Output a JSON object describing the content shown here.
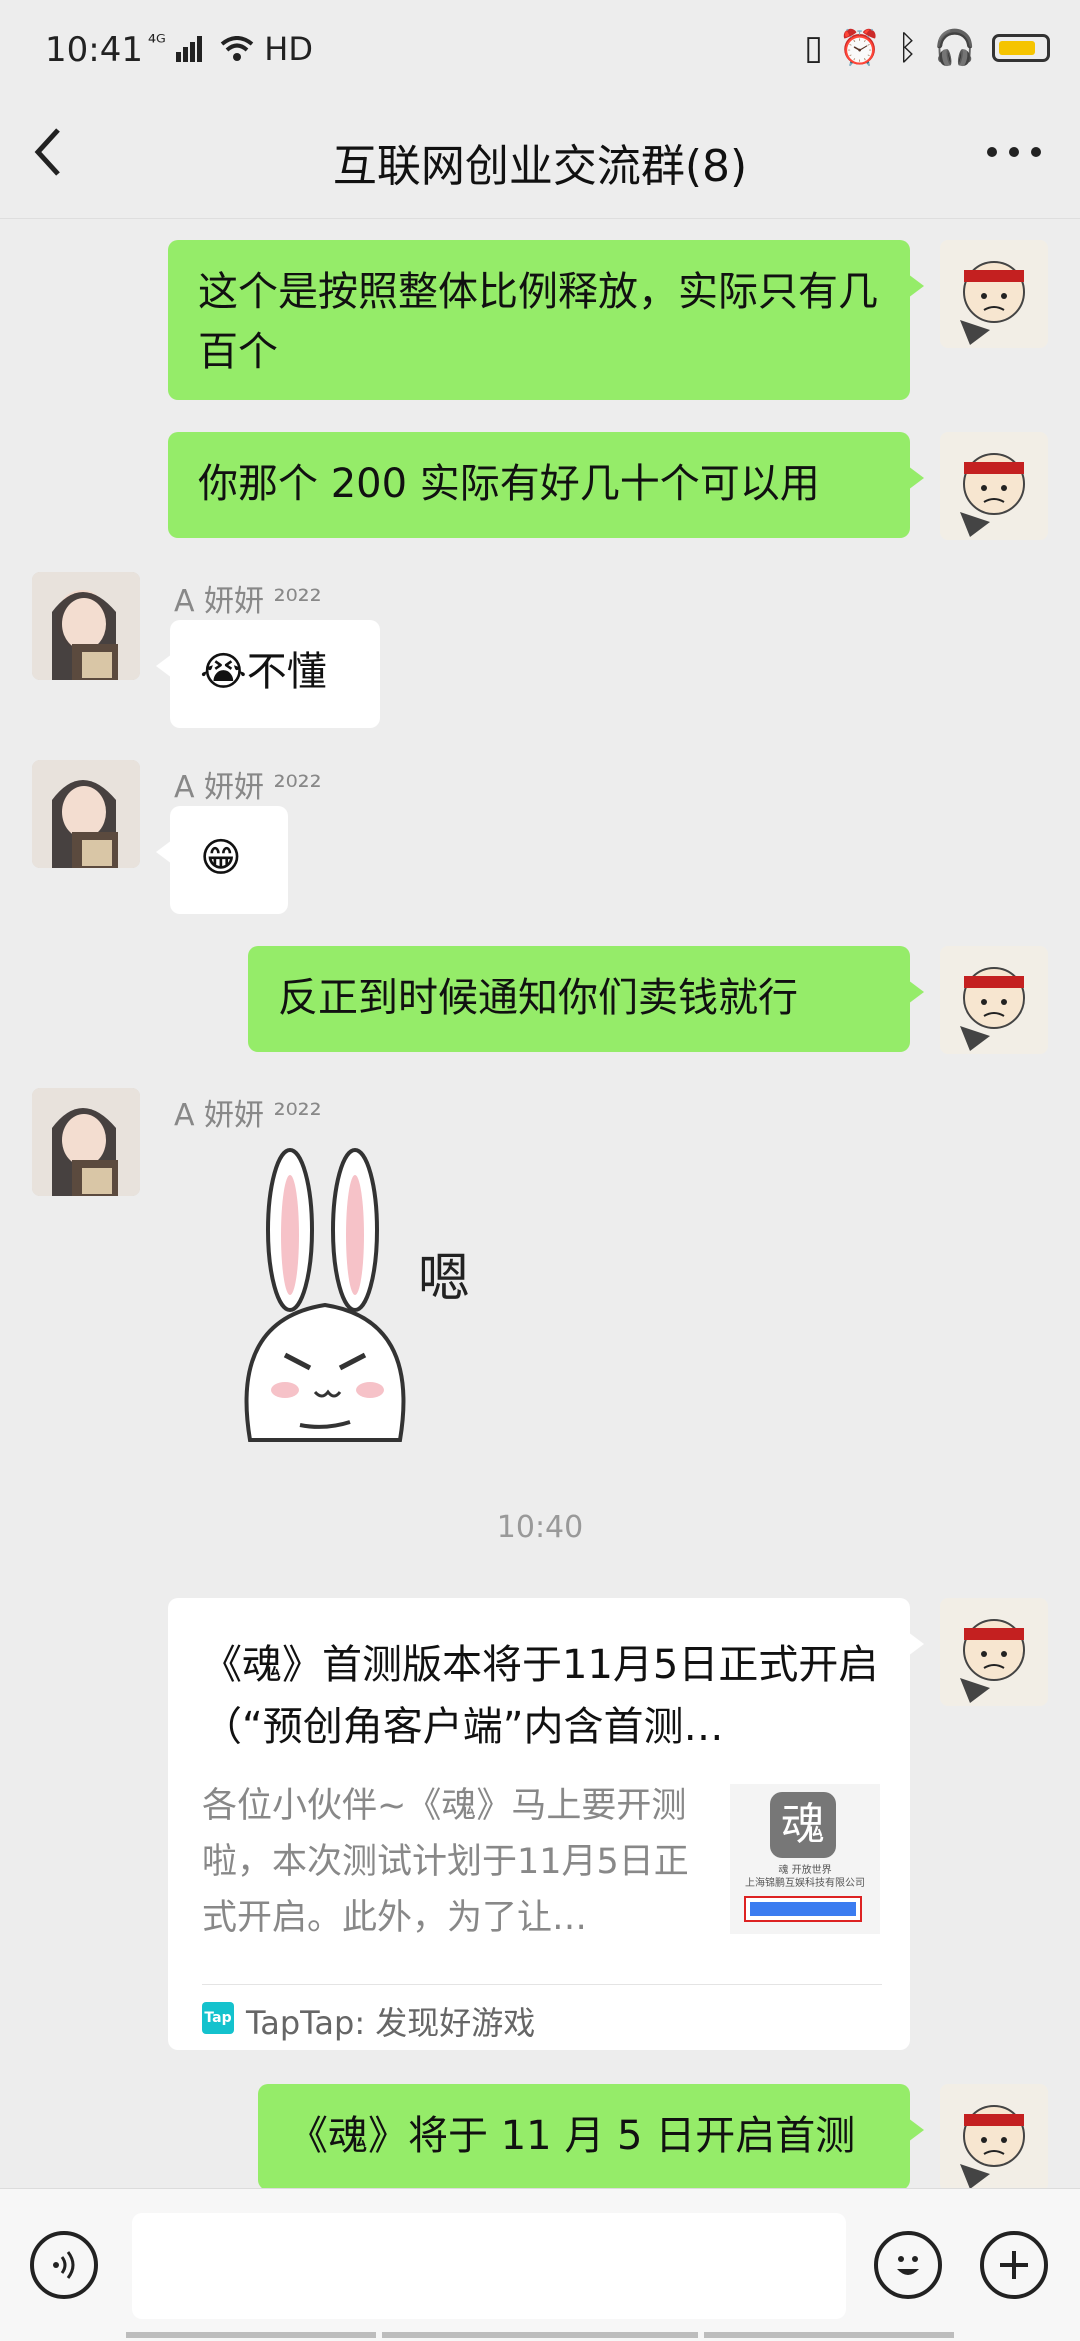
{
  "status_bar": {
    "time": "10:41",
    "signal": "⁴ᴳ",
    "network": "HD"
  },
  "header": {
    "title": "互联网创业交流群(8)"
  },
  "messages": [
    {
      "sender": "me",
      "text": "这个是按照整体比例释放，实际只有几百个"
    },
    {
      "sender": "me",
      "text": "你那个 200 实际有好几十个可以用"
    },
    {
      "sender": "other",
      "name": "A 妍妍 ²⁰²²",
      "text": "😭不懂"
    },
    {
      "sender": "other",
      "name": "A 妍妍 ²⁰²²",
      "text": "😁"
    },
    {
      "sender": "me",
      "text": "反正到时候通知你们卖钱就行"
    },
    {
      "sender": "other",
      "name": "A 妍妍 ²⁰²²",
      "sticker_text": "嗯"
    },
    {
      "timestamp": "10:40"
    },
    {
      "sender": "me",
      "card": {
        "title": "《魂》首测版本将于11月5日正式开启（“预创角客户端”内含首测…",
        "description": "各位小伙伴~《魂》马上要开测啦，本次测试计划于11月5日正式开启。此外，为了让…",
        "thumb_title": "魂",
        "thumb_caption1": "魂 开放世界",
        "thumb_caption2": "上海锦鹏互娱科技有限公司",
        "source_icon": "Tap",
        "source": "TapTap: 发现好游戏"
      }
    },
    {
      "sender": "me",
      "text": "《魂》将于 11 月 5 日开启首测"
    }
  ],
  "input": {
    "placeholder": ""
  },
  "colors": {
    "bubble_me": "#95ec69",
    "bubble_other": "#ffffff",
    "background": "#ededed",
    "taptap": "#14c2cd"
  }
}
